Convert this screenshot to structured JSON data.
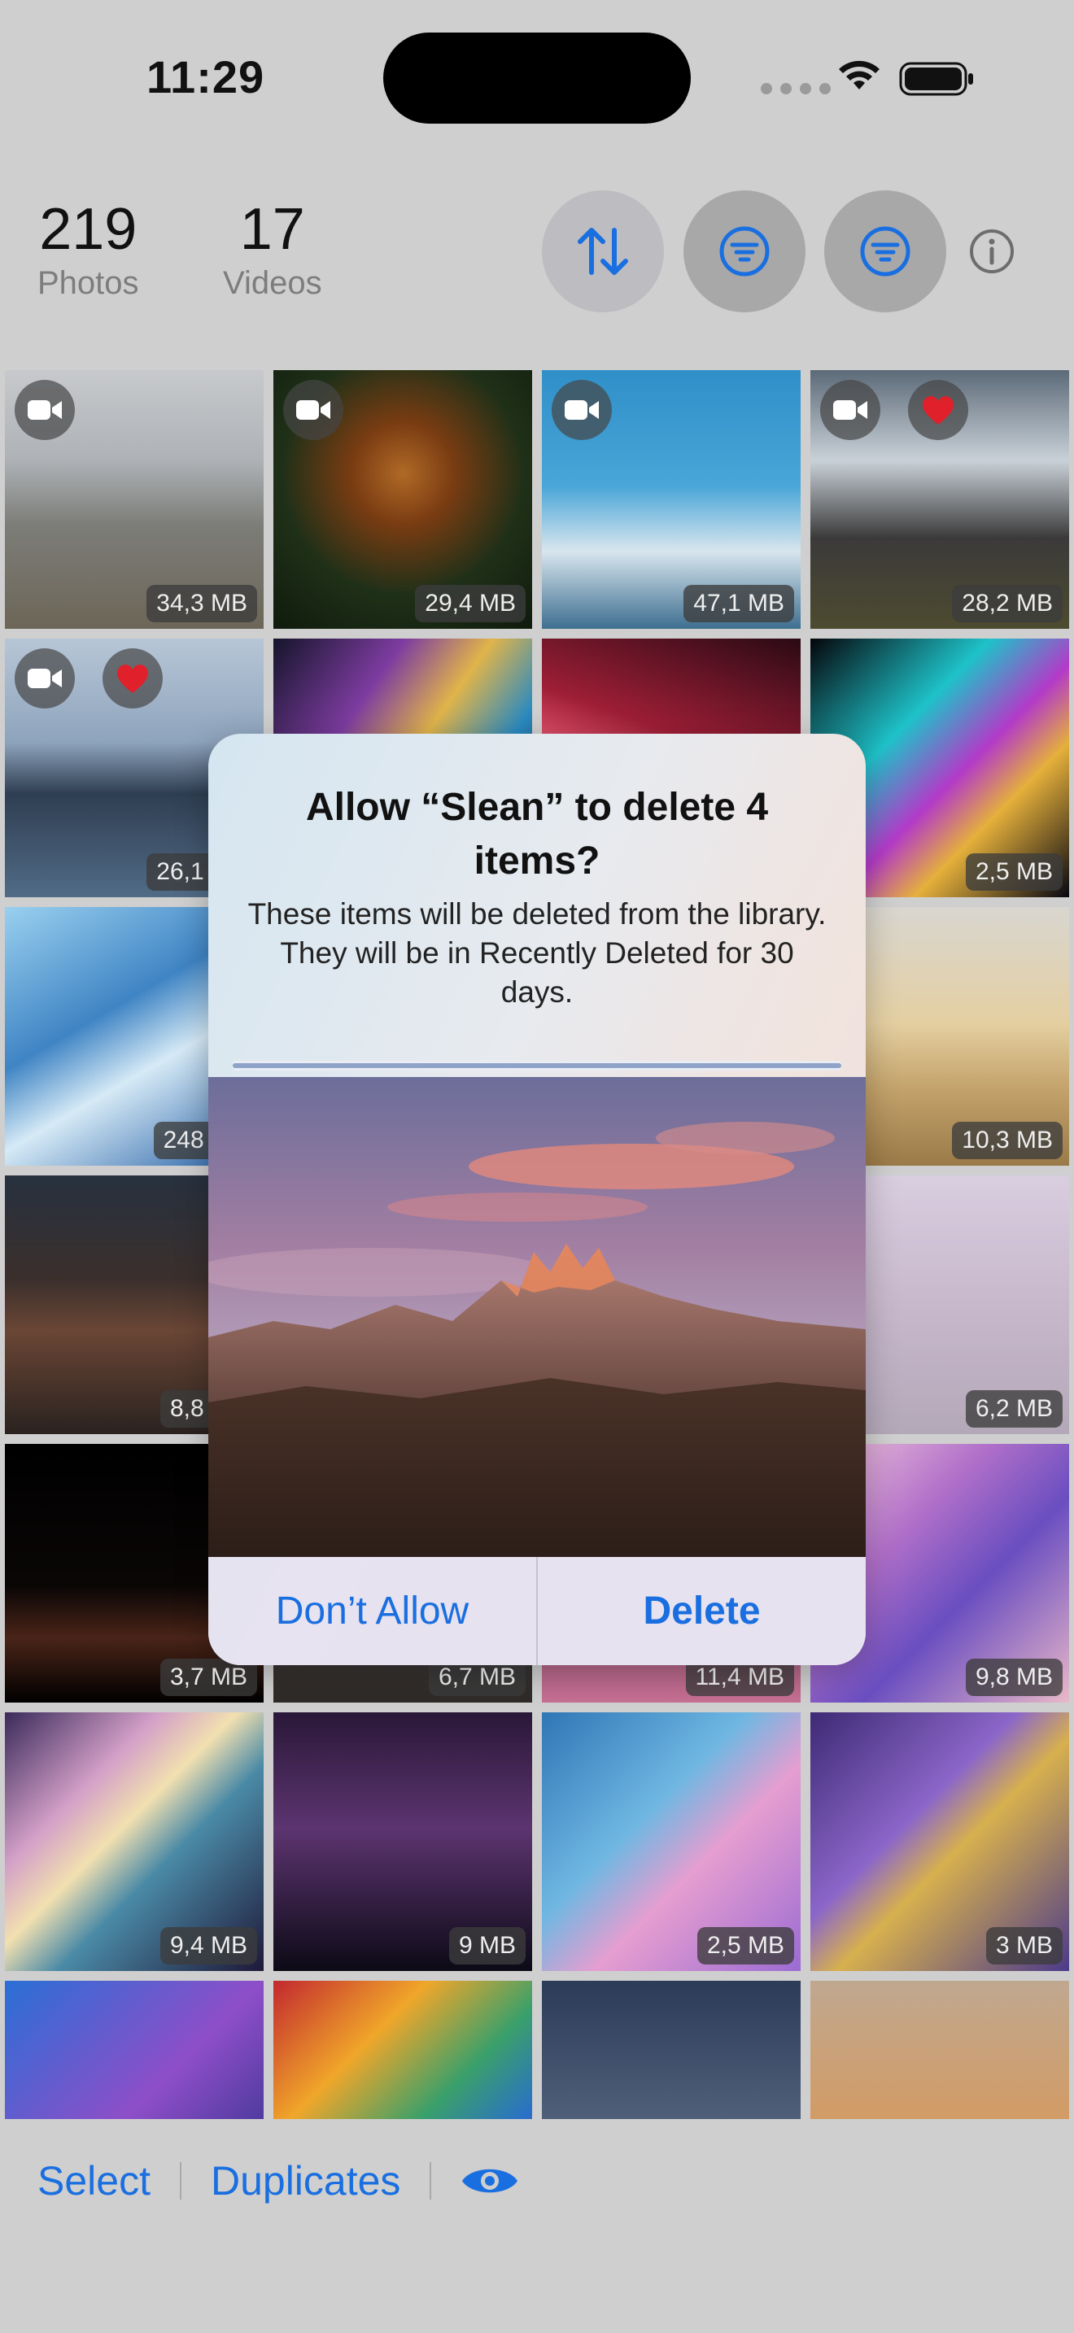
{
  "status_bar": {
    "time": "11:29"
  },
  "header": {
    "photos": {
      "count": "219",
      "label": "Photos"
    },
    "videos": {
      "count": "17",
      "label": "Videos"
    },
    "buttons": [
      "sort-icon",
      "filter-icon",
      "filter-icon",
      "info-icon"
    ]
  },
  "grid": {
    "tiles": [
      {
        "size": "34,3 MB",
        "video": true,
        "favorite": false,
        "bg": "linear-gradient(180deg,#c7c9cc 0%,#aeb2b6 35%,#7c7d78 60%,#6d6658 100%)"
      },
      {
        "size": "29,4 MB",
        "video": true,
        "favorite": false,
        "bg": "radial-gradient(circle at 50% 40%,#b06a26 0%,#7a3c12 25%,#1f3018 60%,#0f1a0c 100%)"
      },
      {
        "size": "47,1 MB",
        "video": true,
        "favorite": false,
        "bg": "linear-gradient(180deg,#2f8fc8 0%,#4aa6d8 45%,#d8e6ee 70%,#3e6f90 100%)"
      },
      {
        "size": "28,2 MB",
        "video": true,
        "favorite": true,
        "bg": "linear-gradient(180deg,#5c6a78 0%,#c9d1d8 35%,#3b3a3a 65%,#4d4b2f 100%)"
      },
      {
        "size": "26,1 MB",
        "video": true,
        "favorite": true,
        "bg": "linear-gradient(180deg,#b7c6d6 0%,#8ea4bd 40%,#2f3e52 60%,#516b86 100%)"
      },
      {
        "size": "",
        "video": false,
        "favorite": false,
        "bg": "linear-gradient(125deg,#15152b 0%,#7d3ca0 30%,#e0b44a 50%,#2a8ac0 70%,#101024 100%)"
      },
      {
        "size": "",
        "video": false,
        "favorite": false,
        "bg": "linear-gradient(200deg,#2a0a14 0%,#9d1e36 40%,#e0506a 55%,#1a0810 100%)"
      },
      {
        "size": "2,5 MB",
        "video": false,
        "favorite": false,
        "bg": "linear-gradient(135deg,#05050a 0%,#1ec2c9 35%,#b33ac8 55%,#e5b03b 70%,#070712 100%)"
      },
      {
        "size": "248 MB",
        "video": false,
        "favorite": false,
        "bg": "linear-gradient(150deg,#9ad0ef 0%,#3f84c4 40%,#d6eaf6 60%,#1e5aa2 100%)"
      },
      {
        "size": "",
        "video": false,
        "favorite": false,
        "bg": "linear-gradient(135deg,#283d64 0%,#5f87c1 100%)"
      },
      {
        "size": "",
        "video": false,
        "favorite": false,
        "bg": "linear-gradient(135deg,#3a3550 0%,#7b6aa0 100%)"
      },
      {
        "size": "10,3 MB",
        "video": false,
        "favorite": false,
        "bg": "linear-gradient(180deg,#d9d6d0 0%,#e4cfa1 45%,#c4a36b 70%,#9a7a48 100%)"
      },
      {
        "size": "8,8 MB",
        "video": false,
        "favorite": false,
        "bg": "linear-gradient(180deg,#27313f 0%,#3b2f2c 40%,#6a4635 60%,#2a221f 100%)"
      },
      {
        "size": "",
        "video": false,
        "favorite": false,
        "bg": "linear-gradient(180deg,#4a4038 0%,#3c3430 100%)"
      },
      {
        "size": "",
        "video": false,
        "favorite": false,
        "bg": "linear-gradient(180deg,#6c5a78 0%,#3f3548 100%)"
      },
      {
        "size": "6,2 MB",
        "video": false,
        "favorite": false,
        "bg": "linear-gradient(180deg,#d9cde0 0%,#c8b8cc 50%,#b3a8b8 100%)"
      },
      {
        "size": "3,7 MB",
        "video": false,
        "favorite": false,
        "bg": "linear-gradient(180deg,#000 0%,#0a0606 55%,#4a2418 75%,#000 100%)"
      },
      {
        "size": "6,7 MB",
        "video": false,
        "favorite": false,
        "bg": "linear-gradient(180deg,#6a6460 0%,#2e2a28 100%)"
      },
      {
        "size": "11,4 MB",
        "video": false,
        "favorite": false,
        "bg": "linear-gradient(180deg,#3e2a44 0%,#c76f93 100%)"
      },
      {
        "size": "9,8 MB",
        "video": false,
        "favorite": false,
        "bg": "linear-gradient(135deg,#f3c9dc 0%,#b06fc9 35%,#6a4ec0 60%,#e9b8c8 100%)"
      },
      {
        "size": "9,4 MB",
        "video": false,
        "favorite": false,
        "bg": "linear-gradient(135deg,#3a2a5a 0%,#d3a0c8 30%,#f2e0b0 45%,#4a8aa6 60%,#1e1838 100%)"
      },
      {
        "size": "9 MB",
        "video": false,
        "favorite": false,
        "bg": "linear-gradient(180deg,#2a1838 0%,#5c3470 45%,#0c0a16 100%)"
      },
      {
        "size": "2,5 MB",
        "video": false,
        "favorite": false,
        "bg": "linear-gradient(135deg,#2f76b6 0%,#6fb7e2 40%,#e59ed0 60%,#9b6bd3 100%)"
      },
      {
        "size": "3 MB",
        "video": false,
        "favorite": false,
        "bg": "linear-gradient(135deg,#3e2a74 0%,#8b66c9 40%,#d7b04e 55%,#4c3a8a 100%)"
      },
      {
        "size": "",
        "video": false,
        "favorite": false,
        "bg": "linear-gradient(135deg,#2a6fd6 0%,#8e4ec8 50%,#1a2a7c 100%)"
      },
      {
        "size": "",
        "video": false,
        "favorite": false,
        "bg": "linear-gradient(135deg,#c2282e 0%,#f0a62a 30%,#3aa06a 55%,#2a70c8 75%,#c23a7a 100%)"
      },
      {
        "size": "",
        "video": false,
        "favorite": false,
        "bg": "linear-gradient(180deg,#2c3c58 0%,#5a6a84 70%,#1a2230 100%)"
      },
      {
        "size": "",
        "video": false,
        "favorite": false,
        "bg": "linear-gradient(180deg,#c0a890 0%,#d49a60 60%,#a8683a 100%)"
      }
    ]
  },
  "alert": {
    "title": "Allow “Slean” to delete 4 items?",
    "message": "These items will be deleted from the library. They will be in Recently Deleted for 30 days.",
    "buttons": {
      "dont_allow": "Don’t Allow",
      "delete": "Delete"
    }
  },
  "toolbar": {
    "select": "Select",
    "duplicates": "Duplicates",
    "preview_icon": "eye-icon"
  },
  "colors": {
    "accent": "#1a6fe0",
    "heart": "#e0202a"
  }
}
